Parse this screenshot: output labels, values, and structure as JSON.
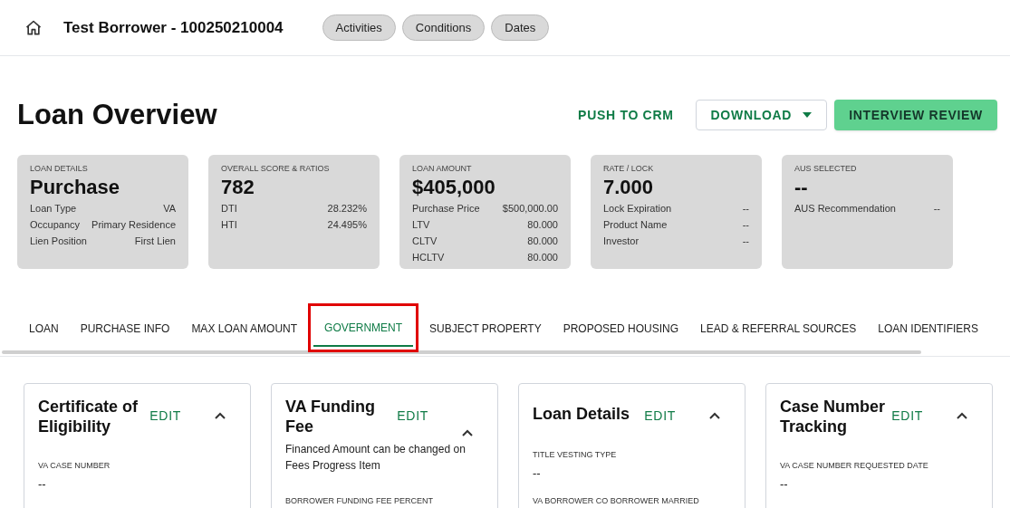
{
  "header": {
    "title": "Test Borrower - 100250210004",
    "pills": [
      "Activities",
      "Conditions",
      "Dates"
    ]
  },
  "page": {
    "title": "Loan Overview",
    "actions": [
      {
        "label": "PUSH TO CRM",
        "kind": "text"
      },
      {
        "label": "DOWNLOAD",
        "kind": "dropdown"
      },
      {
        "label": "INTERVIEW REVIEW",
        "kind": "primary"
      }
    ]
  },
  "summary_cards": [
    {
      "label": "LOAN DETAILS",
      "value": "Purchase",
      "rows": [
        [
          "Loan Type",
          "VA"
        ],
        [
          "Occupancy",
          "Primary Residence"
        ],
        [
          "Lien Position",
          "First Lien"
        ]
      ]
    },
    {
      "label": "OVERALL SCORE & RATIOS",
      "value": "782",
      "rows": [
        [
          "DTI",
          "28.232%"
        ],
        [
          "HTI",
          "24.495%"
        ]
      ]
    },
    {
      "label": "LOAN AMOUNT",
      "value": "$405,000",
      "rows": [
        [
          "Purchase Price",
          "$500,000.00"
        ],
        [
          "LTV",
          "80.000"
        ],
        [
          "CLTV",
          "80.000"
        ],
        [
          "HCLTV",
          "80.000"
        ]
      ]
    },
    {
      "label": "RATE / LOCK",
      "value": "7.000",
      "rows": [
        [
          "Lock Expiration",
          "--"
        ],
        [
          "Product Name",
          "--"
        ],
        [
          "Investor",
          "--"
        ]
      ]
    },
    {
      "label": "AUS SELECTED",
      "value": "--",
      "rows": [
        [
          "AUS Recommendation",
          "--"
        ]
      ]
    }
  ],
  "tabs": [
    {
      "label": "LOAN",
      "selected": false,
      "highlighted": false
    },
    {
      "label": "PURCHASE INFO",
      "selected": false,
      "highlighted": false
    },
    {
      "label": "MAX LOAN AMOUNT",
      "selected": false,
      "highlighted": false
    },
    {
      "label": "GOVERNMENT",
      "selected": true,
      "highlighted": true
    },
    {
      "label": "SUBJECT PROPERTY",
      "selected": false,
      "highlighted": false
    },
    {
      "label": "PROPOSED HOUSING",
      "selected": false,
      "highlighted": false
    },
    {
      "label": "LEAD & REFERRAL SOURCES",
      "selected": false,
      "highlighted": false
    },
    {
      "label": "LOAN IDENTIFIERS",
      "selected": false,
      "highlighted": false
    }
  ],
  "panels": [
    {
      "title": "Certificate of Eligibility",
      "edit": "EDIT",
      "expanded": true,
      "fields": [
        {
          "label": "VA CASE NUMBER",
          "value": "--"
        }
      ]
    },
    {
      "title": "VA Funding Fee",
      "edit": "EDIT",
      "expanded": true,
      "note": "Financed Amount can be changed on Fees Progress Item",
      "fields": [
        {
          "label": "BORROWER FUNDING FEE PERCENT"
        }
      ]
    },
    {
      "title": "Loan Details",
      "edit": "EDIT",
      "expanded": true,
      "fields": [
        {
          "label": "TITLE VESTING TYPE",
          "value": "--"
        },
        {
          "label": "VA BORROWER CO BORROWER MARRIED"
        }
      ]
    },
    {
      "title": "Case Number Tracking",
      "edit": "EDIT",
      "expanded": true,
      "fields": [
        {
          "label": "VA CASE NUMBER REQUESTED DATE",
          "value": "--"
        }
      ]
    }
  ]
}
